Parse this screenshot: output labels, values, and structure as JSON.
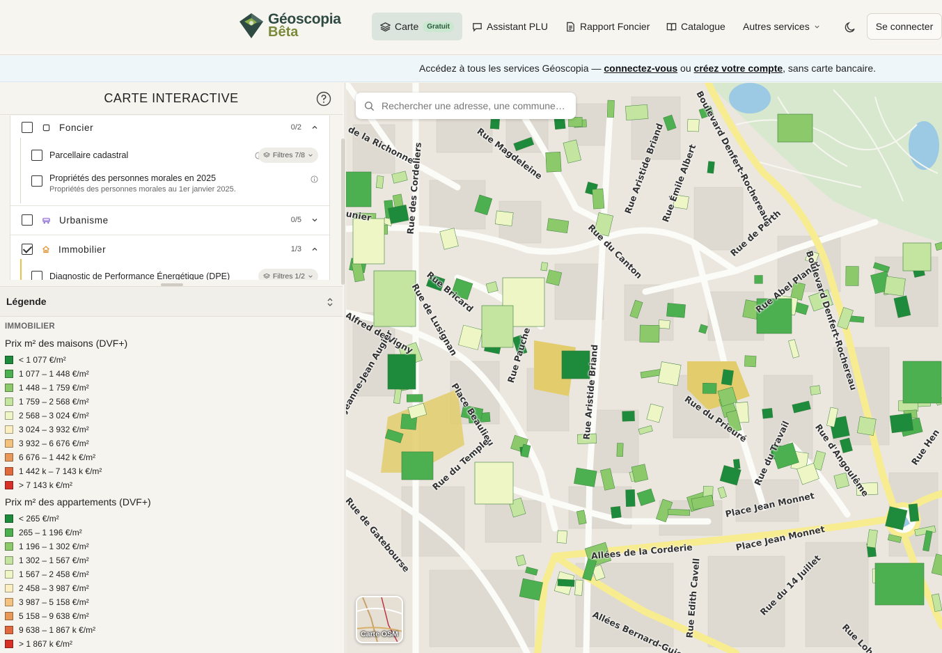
{
  "header": {
    "logo_name": "Géoscopia",
    "logo_beta": "Bêta",
    "nav": {
      "carte": "Carte",
      "carte_badge": "Gratuit",
      "assistant": "Assistant PLU",
      "rapport": "Rapport Foncier",
      "catalogue": "Catalogue",
      "autres": "Autres services"
    },
    "login": "Se connecter"
  },
  "banner": {
    "text_before": "Accédez à tous les services Géoscopia — ",
    "link1": "connectez-vous",
    "text_middle": " ou ",
    "link2": "créez votre compte",
    "text_after": ", sans carte bancaire."
  },
  "panel": {
    "title": "CARTE INTERACTIVE",
    "categories": [
      {
        "label": "Foncier",
        "count": "0/2",
        "checked": false
      },
      {
        "label": "Urbanisme",
        "count": "0/5",
        "checked": false
      },
      {
        "label": "Immobilier",
        "count": "1/3",
        "checked": true
      }
    ],
    "foncier_items": [
      {
        "label": "Parcellaire cadastral",
        "filters": "Filtres 7/8"
      },
      {
        "label": "Propriétés des personnes morales en 2025",
        "desc": "Propriétés des personnes morales au 1er janvier 2025."
      }
    ],
    "immobilier_items": [
      {
        "label": "Diagnostic de Performance Énergétique (DPE)",
        "filters": "Filtres 1/2"
      }
    ]
  },
  "legend": {
    "title": "Légende",
    "section": "IMMOBILIER",
    "maisons_title": "Prix m² des maisons (DVF+)",
    "maisons": [
      {
        "label": "< 1 077 €/m²",
        "color": "#1e8a3c"
      },
      {
        "label": "1 077 – 1 448 €/m²",
        "color": "#4caf50"
      },
      {
        "label": "1 448 – 1 759 €/m²",
        "color": "#8bc96a"
      },
      {
        "label": "1 759 – 2 568 €/m²",
        "color": "#c3e5a0"
      },
      {
        "label": "2 568 – 3 024 €/m²",
        "color": "#eef6c6"
      },
      {
        "label": "3 024 – 3 932 €/m²",
        "color": "#fbeec0"
      },
      {
        "label": "3 932 – 6 676 €/m²",
        "color": "#f4c27f"
      },
      {
        "label": "6 676 – 1 442 k €/m²",
        "color": "#e8995a"
      },
      {
        "label": "1 442 k – 7 143 k €/m²",
        "color": "#e06a3d"
      },
      {
        "label": "> 7 143 k €/m²",
        "color": "#d73027"
      }
    ],
    "apparts_title": "Prix m² des appartements (DVF+)",
    "apparts": [
      {
        "label": "< 265 €/m²",
        "color": "#1e8a3c"
      },
      {
        "label": "265 – 1 196 €/m²",
        "color": "#4caf50"
      },
      {
        "label": "1 196 – 1 302 €/m²",
        "color": "#8bc96a"
      },
      {
        "label": "1 302 – 1 567 €/m²",
        "color": "#c3e5a0"
      },
      {
        "label": "1 567 – 2 458 €/m²",
        "color": "#eef6c6"
      },
      {
        "label": "2 458 – 3 987 €/m²",
        "color": "#fbeec0"
      },
      {
        "label": "3 987 – 5 158 €/m²",
        "color": "#f4c27f"
      },
      {
        "label": "5 158 – 9 638 €/m²",
        "color": "#e8995a"
      },
      {
        "label": "9 638 – 1 867 k €/m²",
        "color": "#e06a3d"
      },
      {
        "label": "> 1 867 k €/m²",
        "color": "#d73027"
      }
    ]
  },
  "map": {
    "search_placeholder": "Rechercher une adresse, une commune…",
    "osm_label": "Carte OSM",
    "streets": [
      "de la Richonne",
      "Rue Magdeleine",
      "Rue des Cordeliers",
      "Rue Aristide Briand",
      "Rue Émile Albert",
      "Boulevard Denfert-Rochereau",
      "Rue de Perth",
      "Rue du Canton",
      "Rue Bricard",
      "Rue de Lusignan",
      "Alfred de Vigny",
      "Rue Abel Planat",
      "Boulevard Denfert-Rochereau",
      "Rue Pauche",
      "Rue Aristide Briand",
      "Jeanne-Jean Augier",
      "Place Beaulieu",
      "Rue du Prieuré",
      "Rue d'Angoulême",
      "Rue du Temple",
      "Rue du Travail",
      "Place Jean Monnet",
      "Place Jean Monnet",
      "Rue de Gatebourse",
      "Allées de la Corderie",
      "Rue Edith Cavell",
      "Rue du 14 Juillet",
      "Allées Bernard-Guionne",
      "Rue Lohm",
      "Rue Hen",
      "unier"
    ]
  }
}
